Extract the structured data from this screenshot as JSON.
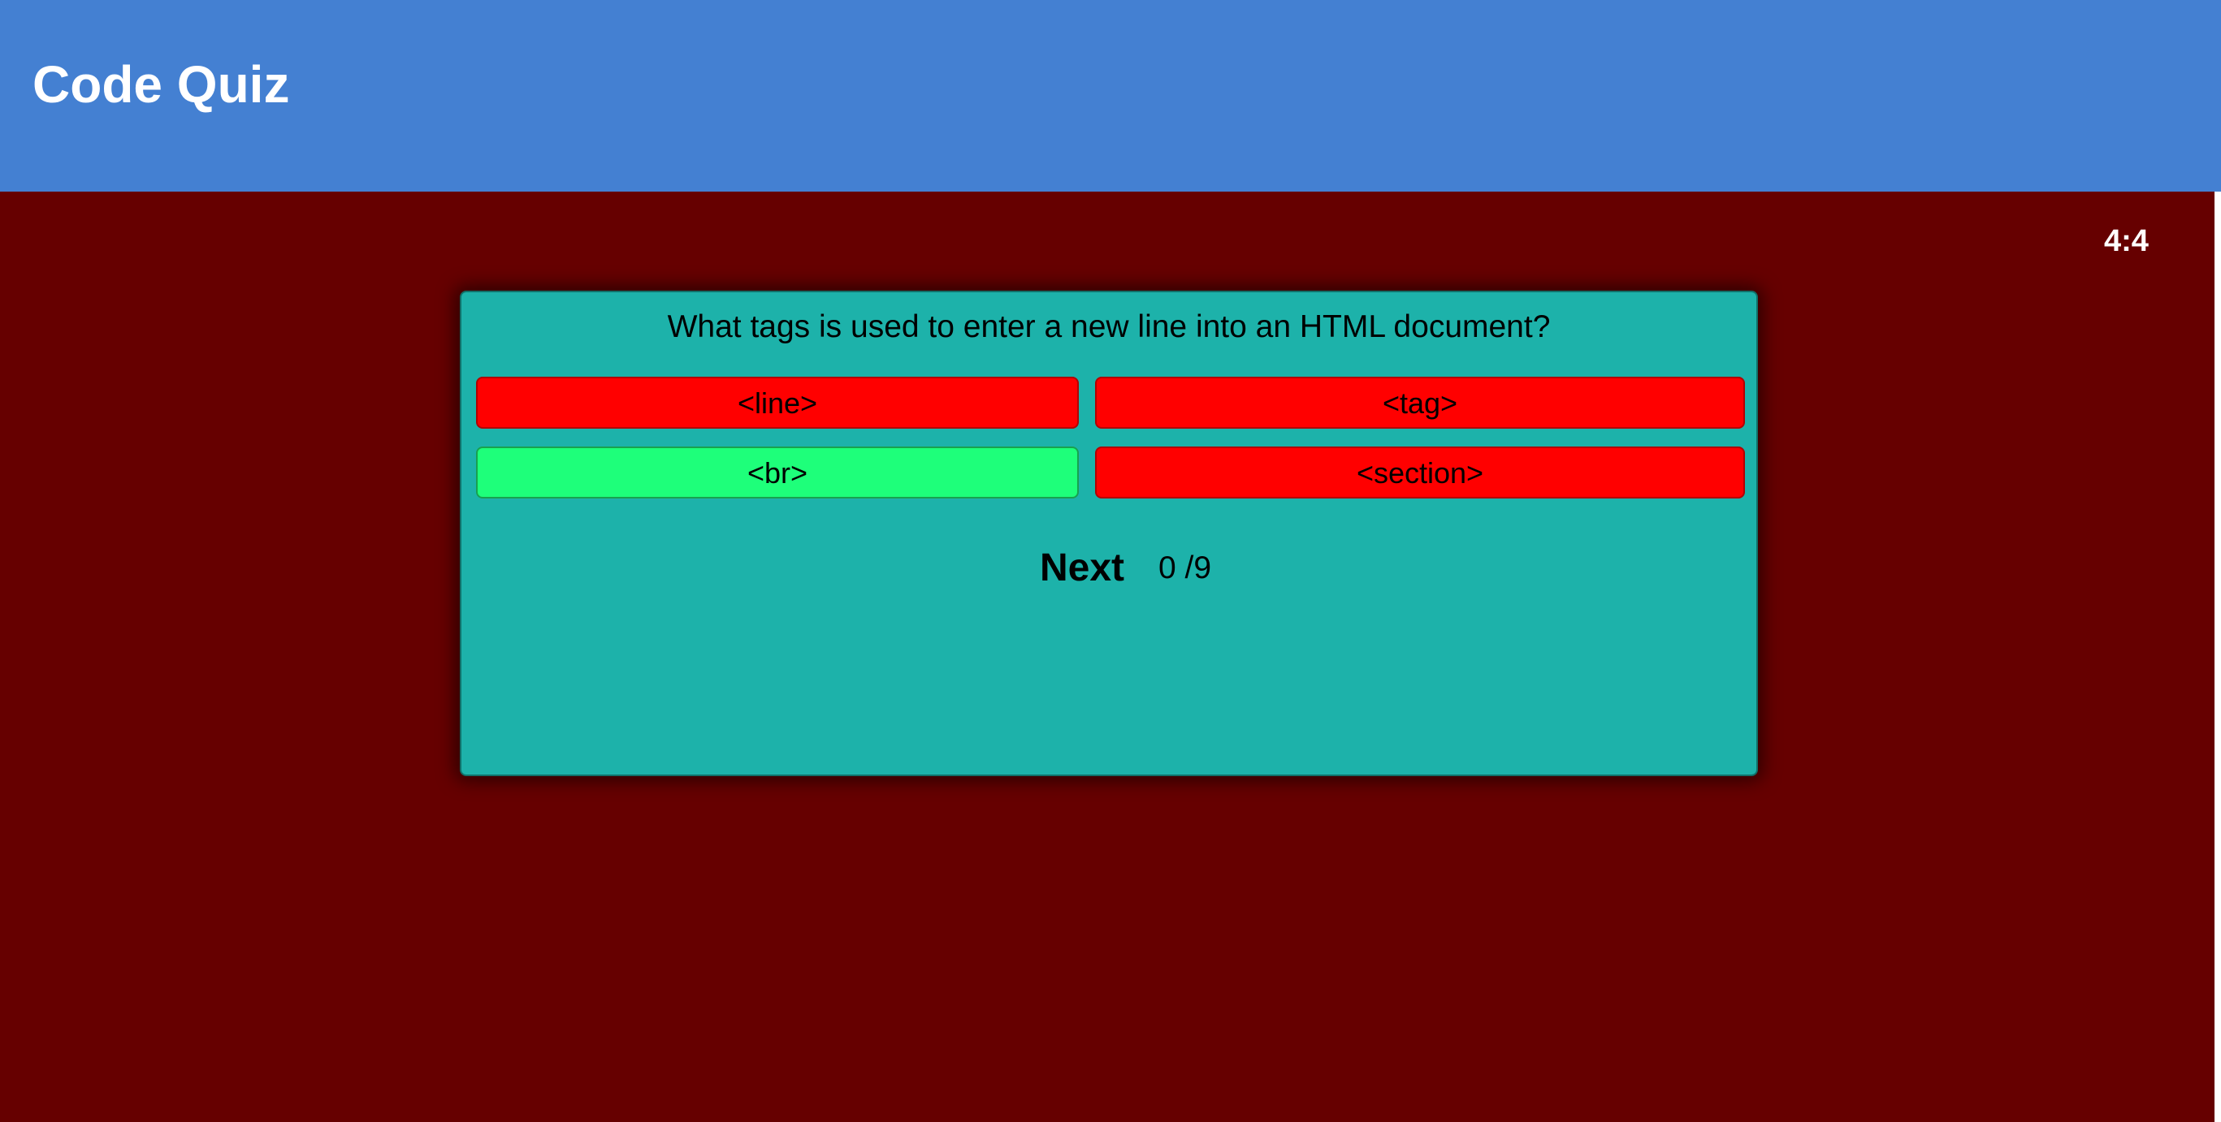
{
  "header": {
    "title": "Code Quiz"
  },
  "timer": {
    "value": "4:4"
  },
  "quiz": {
    "question": "What tags is used to enter a new line into an HTML document?",
    "answers": [
      {
        "label": "<line>",
        "state": "wrong"
      },
      {
        "label": "<tag>",
        "state": "wrong"
      },
      {
        "label": "<br>",
        "state": "correct"
      },
      {
        "label": "<section>",
        "state": "wrong"
      }
    ],
    "next_label": "Next",
    "progress": "0 /9"
  },
  "colors": {
    "header_bg": "#4480d2",
    "page_bg": "#660000",
    "card_bg": "#1db2aa",
    "wrong": "#ff0000",
    "correct": "#1eff7a"
  }
}
